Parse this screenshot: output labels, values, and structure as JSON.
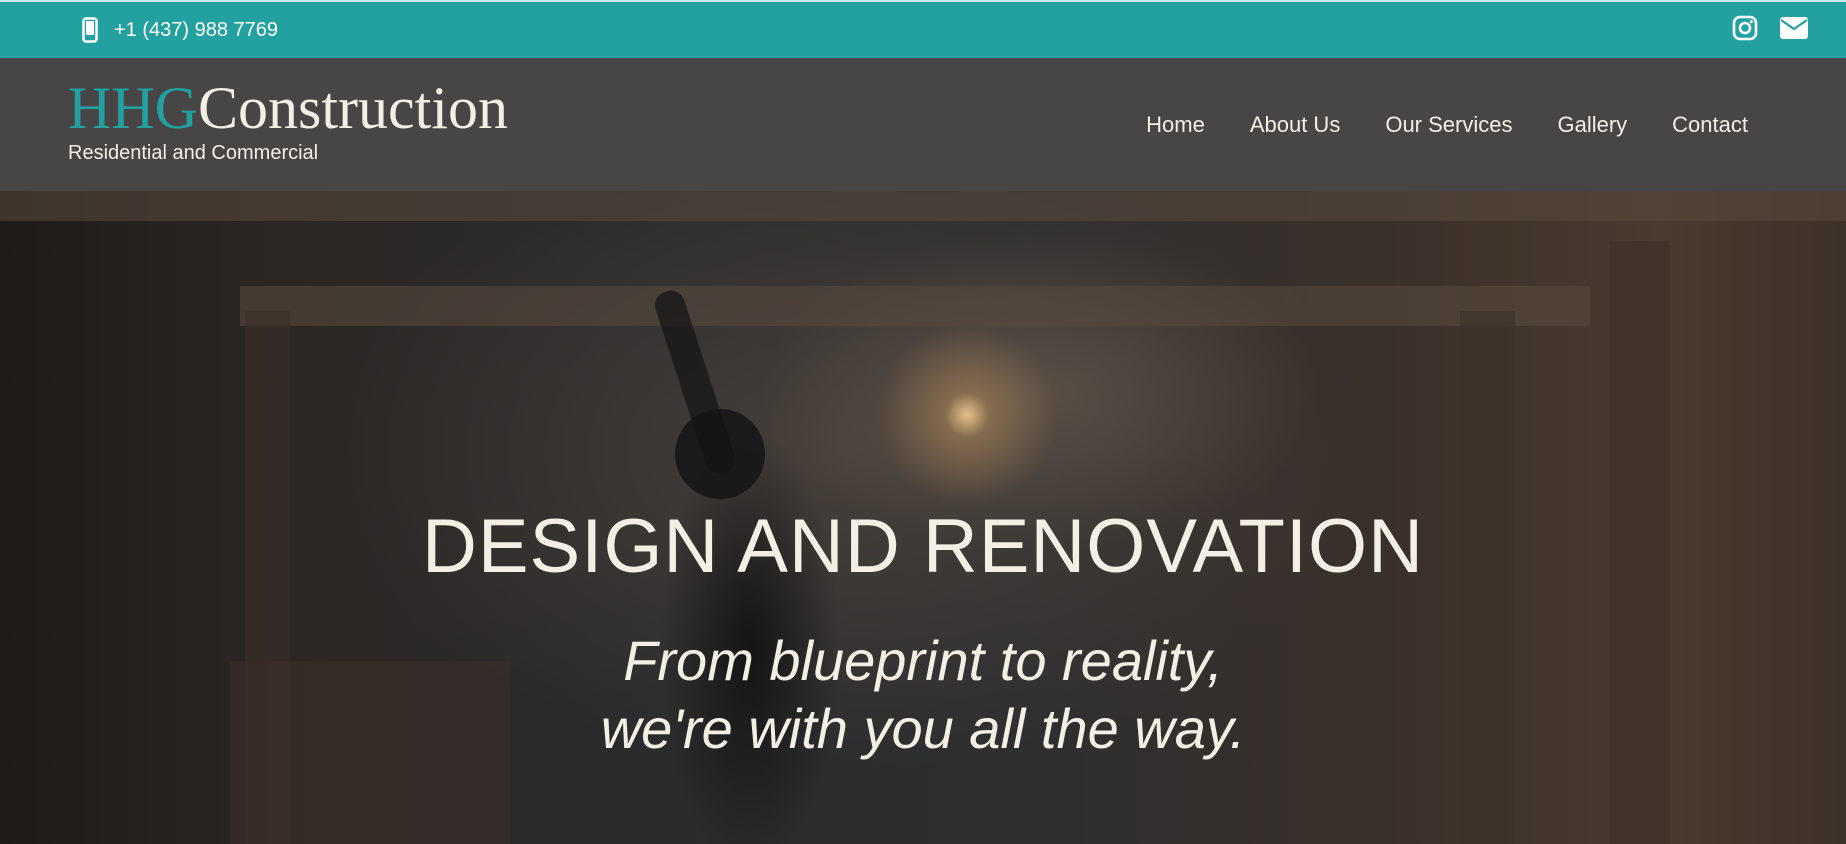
{
  "topbar": {
    "phone_icon": "mobile-phone-icon",
    "phone": "+1 (437) 988 7769",
    "social": [
      {
        "name": "instagram-icon"
      },
      {
        "name": "envelope-icon"
      }
    ],
    "bg_color": "#23a1a0"
  },
  "header": {
    "logo_hhg": "HHG",
    "logo_construction": "Construction",
    "logo_subtitle": "Residential and Commercial",
    "nav": [
      "Home",
      "About Us",
      "Our Services",
      "Gallery",
      "Contact"
    ],
    "bg_color": "#474546",
    "accent_color": "#23a1a0"
  },
  "hero": {
    "title": "DESIGN AND RENOVATION",
    "subtitle_line1": "From blueprint to reality,",
    "subtitle_line2": "we're with you all the way."
  }
}
